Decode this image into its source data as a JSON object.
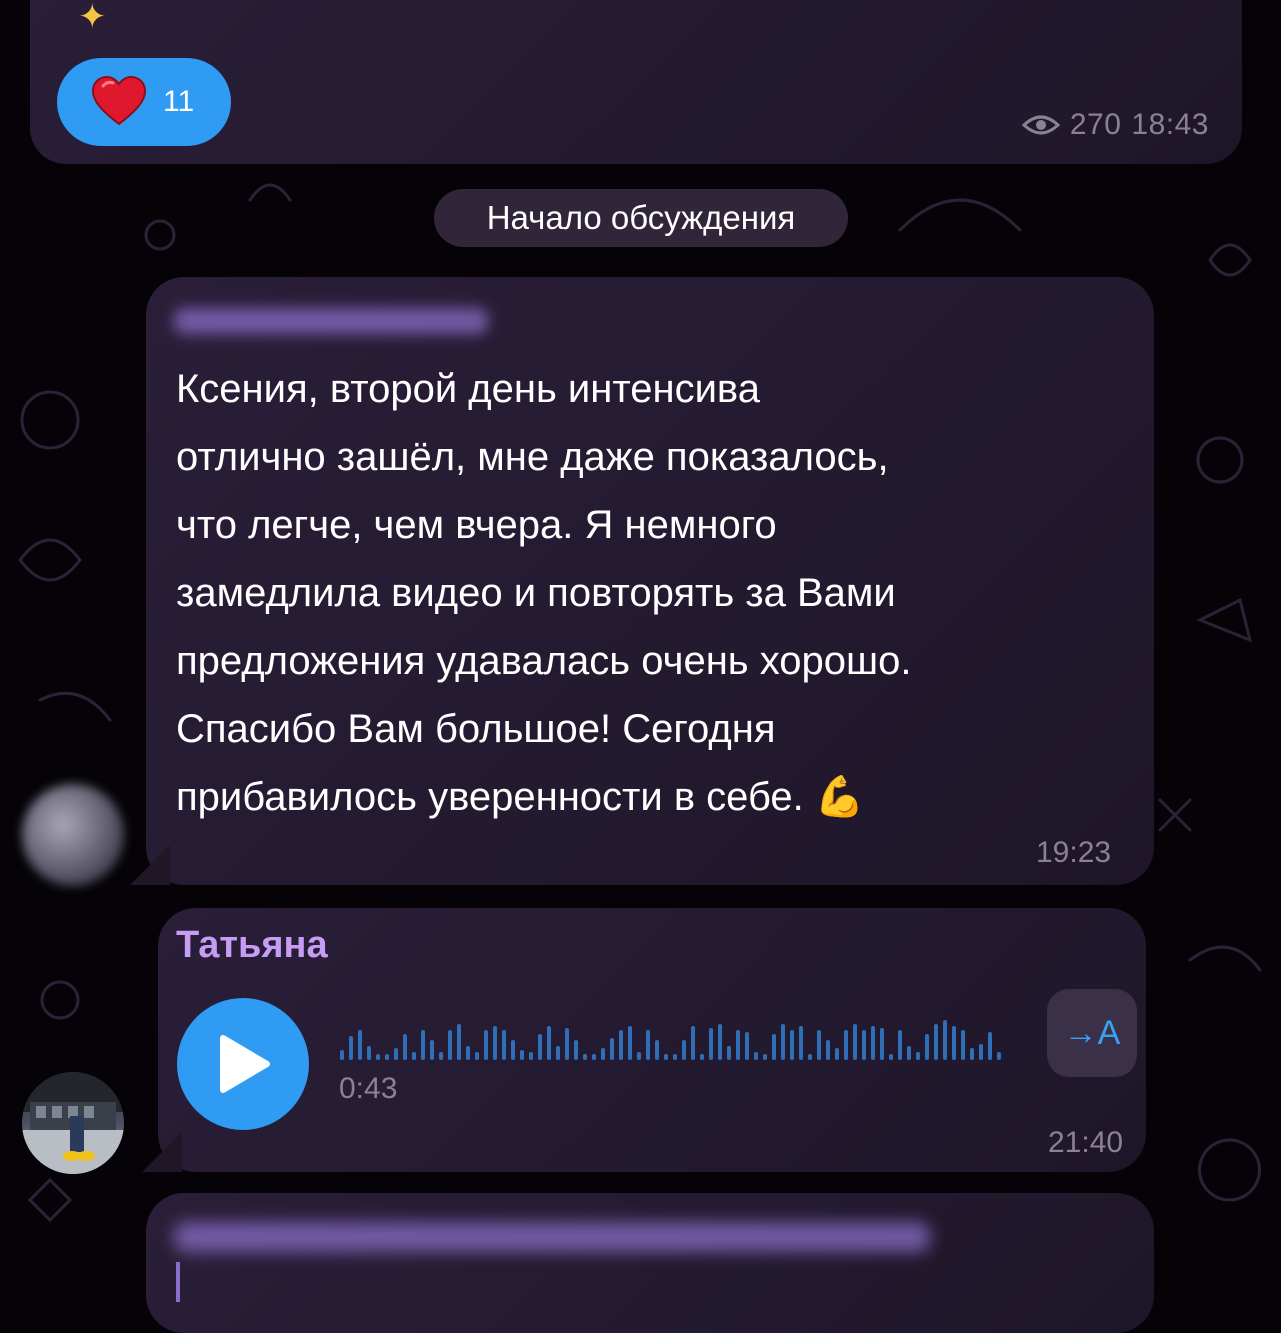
{
  "post": {
    "sparkle_icon": "sparkle",
    "reaction": {
      "emoji": "heart",
      "count": "11"
    },
    "views": "270",
    "time": "18:43"
  },
  "service_message": "Начало обсуждения",
  "messages": [
    {
      "sender_hidden": true,
      "text": "Ксения, второй день интенсива\nотлично зашёл, мне даже показалось,\nчто легче, чем вчера. Я немного\nзамедлила видео и повторять за Вами\nпредложения удавалась очень хорошо.\nСпасибо Вам большое! Сегодня\nприбавилось уверенности в себе. 💪",
      "time": "19:23"
    },
    {
      "sender": "Татьяна",
      "voice": {
        "duration": "0:43"
      },
      "transcribe_label": "→A",
      "time": "21:40"
    },
    {
      "sender_hidden": true
    }
  ],
  "colors": {
    "accent": "#2f9bf2",
    "sender_name": "#c79cf5",
    "meta_text": "#8b8196",
    "bubble": "#2a1e38"
  }
}
